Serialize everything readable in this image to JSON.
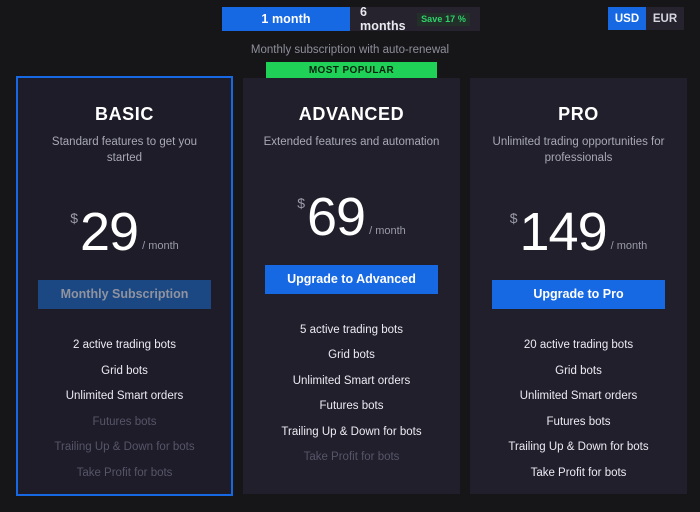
{
  "header": {
    "period_toggle": {
      "options": [
        {
          "label": "1 month",
          "active": true
        },
        {
          "label": "6 months",
          "active": false,
          "badge": "Save 17 %"
        }
      ]
    },
    "currency_toggle": {
      "options": [
        {
          "label": "USD",
          "active": true
        },
        {
          "label": "EUR",
          "active": false
        }
      ]
    },
    "subtitle": "Monthly subscription with auto-renewal"
  },
  "badges": {
    "most_popular": "MOST POPULAR"
  },
  "plans": [
    {
      "name": "BASIC",
      "description": "Standard features to get you started",
      "currency_symbol": "$",
      "price": "29",
      "period": "/ month",
      "cta_label": "Monthly Subscription",
      "cta_state": "current",
      "features": [
        {
          "label": "2 active trading bots",
          "included": true
        },
        {
          "label": "Grid bots",
          "included": true
        },
        {
          "label": "Unlimited Smart orders",
          "included": true
        },
        {
          "label": "Futures bots",
          "included": false
        },
        {
          "label": "Trailing Up & Down for bots",
          "included": false
        },
        {
          "label": "Take Profit for bots",
          "included": false
        }
      ]
    },
    {
      "name": "ADVANCED",
      "description": "Extended features and automation",
      "currency_symbol": "$",
      "price": "69",
      "period": "/ month",
      "cta_label": "Upgrade to Advanced",
      "cta_state": "upgrade",
      "features": [
        {
          "label": "5 active trading bots",
          "included": true
        },
        {
          "label": "Grid bots",
          "included": true
        },
        {
          "label": "Unlimited Smart orders",
          "included": true
        },
        {
          "label": "Futures bots",
          "included": true
        },
        {
          "label": "Trailing Up & Down for bots",
          "included": true
        },
        {
          "label": "Take Profit for bots",
          "included": false
        }
      ]
    },
    {
      "name": "PRO",
      "description": "Unlimited trading opportunities for professionals",
      "currency_symbol": "$",
      "price": "149",
      "period": "/ month",
      "cta_label": "Upgrade to Pro",
      "cta_state": "upgrade",
      "features": [
        {
          "label": "20 active trading bots",
          "included": true
        },
        {
          "label": "Grid bots",
          "included": true
        },
        {
          "label": "Unlimited Smart orders",
          "included": true
        },
        {
          "label": "Futures bots",
          "included": true
        },
        {
          "label": "Trailing Up & Down for bots",
          "included": true
        },
        {
          "label": "Take Profit for bots",
          "included": true
        }
      ]
    }
  ],
  "colors": {
    "page_background": "#161618",
    "card_background": "#211f2b",
    "accent_blue": "#1668e3",
    "accent_green": "#1fd157",
    "muted_text": "#56556a"
  }
}
